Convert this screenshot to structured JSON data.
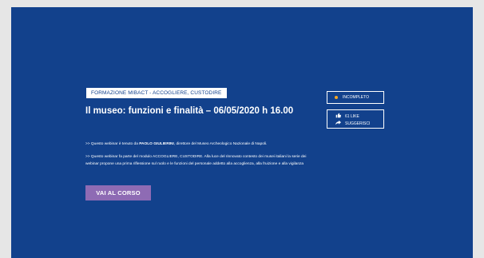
{
  "course": {
    "tag": "FORMAZIONE MIBACT - ACCOGLIERE, CUSTODIRE",
    "title": "Il museo: funzioni e finalità – 06/05/2020 h 16.00",
    "status_label": "INCOMPLETO",
    "likes_label": "61 LIKE",
    "share_label": "SUGGERISCI",
    "cta_label": "VAI AL CORSO"
  },
  "description": {
    "line1_prefix": ">> Questo webinar è tenuto da ",
    "line1_strong": "PAOLO GIULIERINI",
    "line1_suffix": ", direttore del Museo Archeologico Nazionale di Napoli.",
    "line2": ">> Questo webinar fa parte del modulo ACCOGLIERE, CUSTODIRE. Alla luce del rinnovato contesto dei musei italiani la serie dei",
    "line3": "webinar propone una prima riflessione sul ruolo e le funzioni del personale addetto alla accoglienza, alla fruizione e alla vigilanza"
  },
  "colors": {
    "background": "#12418c",
    "accent": "#8e6bb4",
    "status_dot": "#f5a623"
  },
  "icons": {
    "like": "thumbs-up-icon",
    "share": "share-arrow-icon",
    "status": "status-dot-icon"
  }
}
